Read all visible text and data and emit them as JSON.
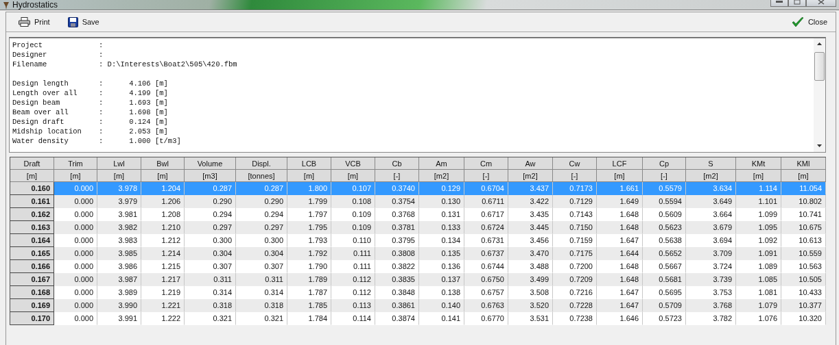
{
  "window": {
    "title": "Hydrostatics"
  },
  "toolbar": {
    "left": [
      {
        "kind": "print",
        "label": "Print"
      },
      {
        "kind": "save",
        "label": "Save"
      }
    ],
    "right": [
      {
        "kind": "close",
        "label": "Close"
      }
    ]
  },
  "report": {
    "sections": [
      [
        "Project             :",
        "Designer            :",
        "Filename            : D:\\Interests\\Boat2\\505\\420.fbm"
      ],
      [
        "Design length       :      4.106 [m]",
        "Length over all     :      4.199 [m]",
        "Design beam         :      1.693 [m]",
        "Beam over all       :      1.698 [m]",
        "Design draft        :      0.124 [m]",
        "Midship location    :      2.053 [m]",
        "Water density       :      1.000 [t/m3]"
      ]
    ]
  },
  "table": {
    "columns": [
      {
        "name": "Draft",
        "unit": "[m]"
      },
      {
        "name": "Trim",
        "unit": "[m]"
      },
      {
        "name": "Lwl",
        "unit": "[m]"
      },
      {
        "name": "Bwl",
        "unit": "[m]"
      },
      {
        "name": "Volume",
        "unit": "[m3]"
      },
      {
        "name": "Displ.",
        "unit": "[tonnes]"
      },
      {
        "name": "LCB",
        "unit": "[m]"
      },
      {
        "name": "VCB",
        "unit": "[m]"
      },
      {
        "name": "Cb",
        "unit": "[-]"
      },
      {
        "name": "Am",
        "unit": "[m2]"
      },
      {
        "name": "Cm",
        "unit": "[-]"
      },
      {
        "name": "Aw",
        "unit": "[m2]"
      },
      {
        "name": "Cw",
        "unit": "[-]"
      },
      {
        "name": "LCF",
        "unit": "[m]"
      },
      {
        "name": "Cp",
        "unit": "[-]"
      },
      {
        "name": "S",
        "unit": "[m2]"
      },
      {
        "name": "KMt",
        "unit": "[m]"
      },
      {
        "name": "KMl",
        "unit": "[m]"
      }
    ],
    "rows": [
      {
        "selected": true,
        "cells": [
          "0.160",
          "0.000",
          "3.978",
          "1.204",
          "0.287",
          "0.287",
          "1.800",
          "0.107",
          "0.3740",
          "0.129",
          "0.6704",
          "3.437",
          "0.7173",
          "1.661",
          "0.5579",
          "3.634",
          "1.114",
          "11.054"
        ]
      },
      {
        "selected": false,
        "cells": [
          "0.161",
          "0.000",
          "3.979",
          "1.206",
          "0.290",
          "0.290",
          "1.799",
          "0.108",
          "0.3754",
          "0.130",
          "0.6711",
          "3.422",
          "0.7129",
          "1.649",
          "0.5594",
          "3.649",
          "1.101",
          "10.802"
        ]
      },
      {
        "selected": false,
        "cells": [
          "0.162",
          "0.000",
          "3.981",
          "1.208",
          "0.294",
          "0.294",
          "1.797",
          "0.109",
          "0.3768",
          "0.131",
          "0.6717",
          "3.435",
          "0.7143",
          "1.648",
          "0.5609",
          "3.664",
          "1.099",
          "10.741"
        ]
      },
      {
        "selected": false,
        "cells": [
          "0.163",
          "0.000",
          "3.982",
          "1.210",
          "0.297",
          "0.297",
          "1.795",
          "0.109",
          "0.3781",
          "0.133",
          "0.6724",
          "3.445",
          "0.7150",
          "1.648",
          "0.5623",
          "3.679",
          "1.095",
          "10.675"
        ]
      },
      {
        "selected": false,
        "cells": [
          "0.164",
          "0.000",
          "3.983",
          "1.212",
          "0.300",
          "0.300",
          "1.793",
          "0.110",
          "0.3795",
          "0.134",
          "0.6731",
          "3.456",
          "0.7159",
          "1.647",
          "0.5638",
          "3.694",
          "1.092",
          "10.613"
        ]
      },
      {
        "selected": false,
        "cells": [
          "0.165",
          "0.000",
          "3.985",
          "1.214",
          "0.304",
          "0.304",
          "1.792",
          "0.111",
          "0.3808",
          "0.135",
          "0.6737",
          "3.470",
          "0.7175",
          "1.644",
          "0.5652",
          "3.709",
          "1.091",
          "10.559"
        ]
      },
      {
        "selected": false,
        "cells": [
          "0.166",
          "0.000",
          "3.986",
          "1.215",
          "0.307",
          "0.307",
          "1.790",
          "0.111",
          "0.3822",
          "0.136",
          "0.6744",
          "3.488",
          "0.7200",
          "1.648",
          "0.5667",
          "3.724",
          "1.089",
          "10.563"
        ]
      },
      {
        "selected": false,
        "cells": [
          "0.167",
          "0.000",
          "3.987",
          "1.217",
          "0.311",
          "0.311",
          "1.789",
          "0.112",
          "0.3835",
          "0.137",
          "0.6750",
          "3.499",
          "0.7209",
          "1.648",
          "0.5681",
          "3.739",
          "1.085",
          "10.505"
        ]
      },
      {
        "selected": false,
        "cells": [
          "0.168",
          "0.000",
          "3.989",
          "1.219",
          "0.314",
          "0.314",
          "1.787",
          "0.112",
          "0.3848",
          "0.138",
          "0.6757",
          "3.508",
          "0.7216",
          "1.647",
          "0.5695",
          "3.753",
          "1.081",
          "10.433"
        ]
      },
      {
        "selected": false,
        "cells": [
          "0.169",
          "0.000",
          "3.990",
          "1.221",
          "0.318",
          "0.318",
          "1.785",
          "0.113",
          "0.3861",
          "0.140",
          "0.6763",
          "3.520",
          "0.7228",
          "1.647",
          "0.5709",
          "3.768",
          "1.079",
          "10.377"
        ]
      },
      {
        "selected": false,
        "cells": [
          "0.170",
          "0.000",
          "3.991",
          "1.222",
          "0.321",
          "0.321",
          "1.784",
          "0.114",
          "0.3874",
          "0.141",
          "0.6770",
          "3.531",
          "0.7238",
          "1.646",
          "0.5723",
          "3.782",
          "1.076",
          "10.320"
        ]
      }
    ]
  }
}
